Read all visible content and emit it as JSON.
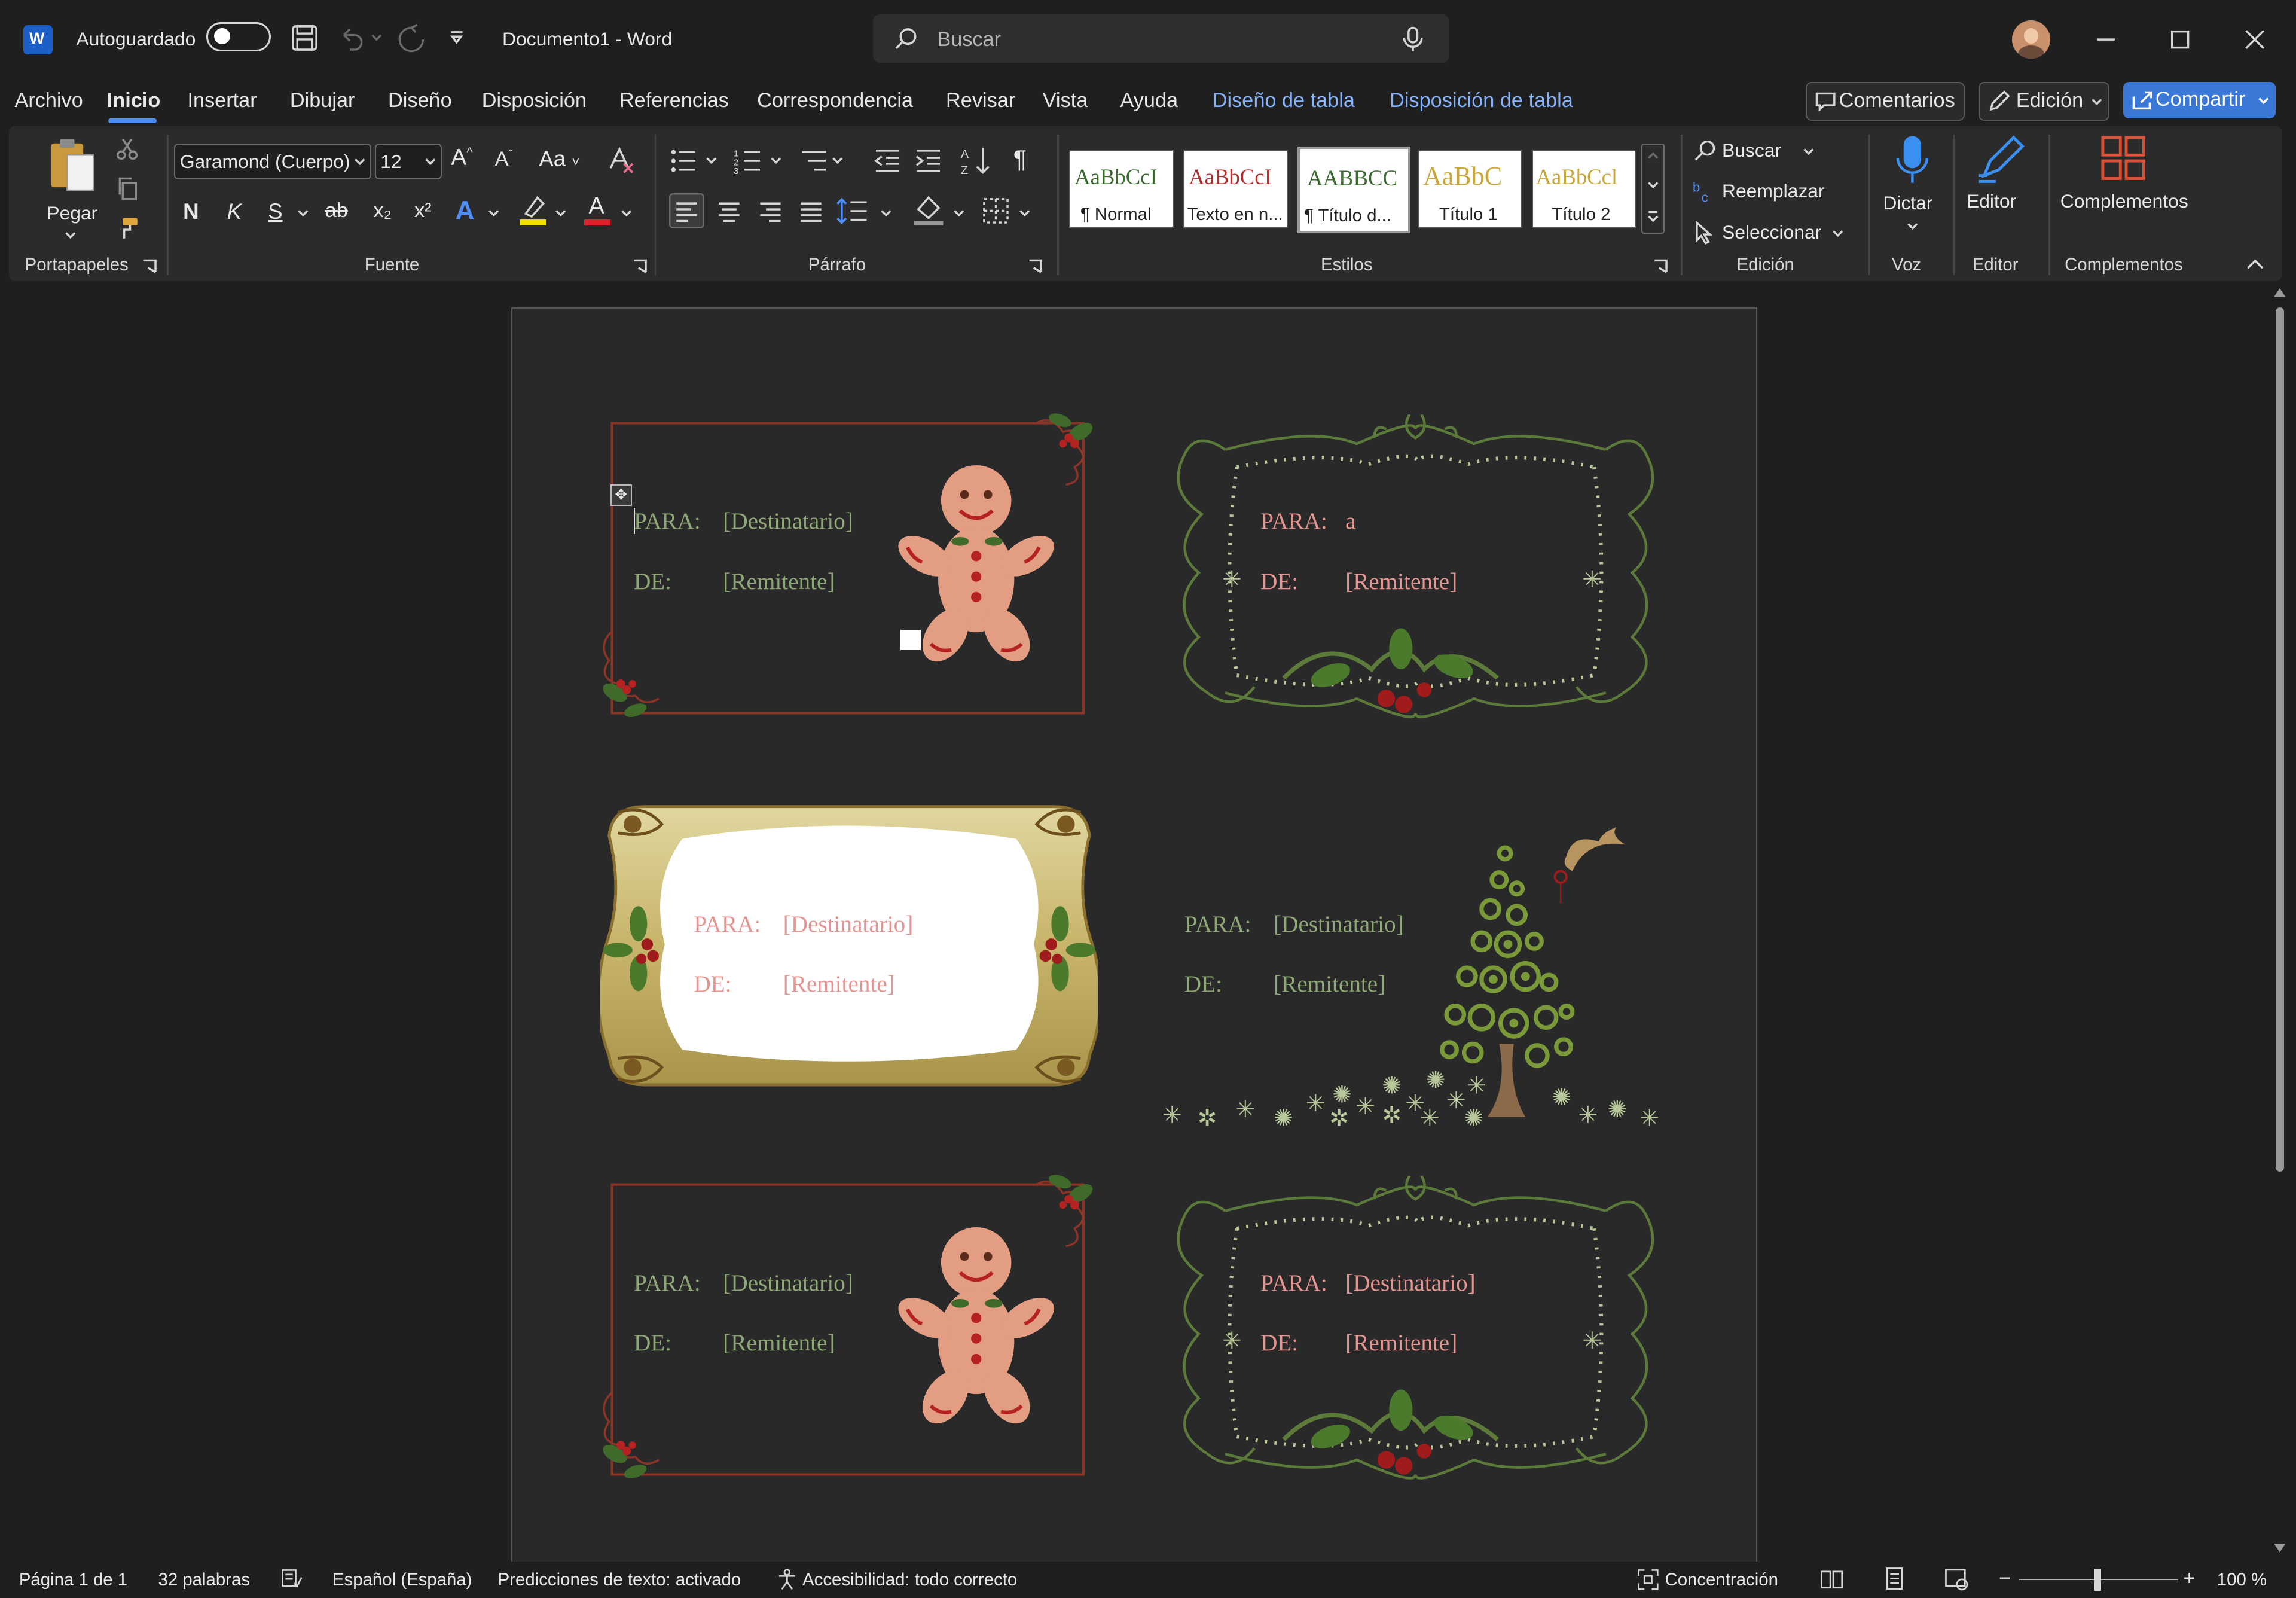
{
  "title": {
    "autosave_label": "Autoguardado",
    "doc_title": "Documento1  -  Word",
    "search_placeholder": "Buscar"
  },
  "menu": {
    "items": [
      "Archivo",
      "Inicio",
      "Insertar",
      "Dibujar",
      "Diseño",
      "Disposición",
      "Referencias",
      "Correspondencia",
      "Revisar",
      "Vista",
      "Ayuda"
    ],
    "contextual": [
      "Diseño de tabla",
      "Disposición de tabla"
    ],
    "comments": "Comentarios",
    "editing": "Edición",
    "share": "Compartir"
  },
  "ribbon": {
    "paste": "Pegar",
    "font_name": "Garamond (Cuerpo)",
    "font_size": "12",
    "case_label": "Aa",
    "bold": "N",
    "italic": "K",
    "underline": "S",
    "strike": "ab",
    "sub": "x₂",
    "sup": "x²",
    "styles": [
      {
        "preview": "AaBbCcI",
        "name": "¶ Normal",
        "color": "#3a6b2f"
      },
      {
        "preview": "AaBbCcI",
        "name": "Texto en n...",
        "color": "#b03030"
      },
      {
        "preview": "AABBCC",
        "name": "¶ Título d...",
        "color": "#3a6b2f"
      },
      {
        "preview": "AaBbC",
        "name": "Título 1",
        "color": "#c9a73a"
      },
      {
        "preview": "AaBbCcl",
        "name": "Título 2",
        "color": "#c9a73a"
      }
    ],
    "search": "Buscar",
    "replace": "Reemplazar",
    "select": "Seleccionar",
    "dictate": "Dictar",
    "editor": "Editor",
    "addins": "Complementos",
    "groups": {
      "clipboard": "Portapapeles",
      "font": "Fuente",
      "paragraph": "Párrafo",
      "styles": "Estilos",
      "editing": "Edición",
      "voice": "Voz",
      "editor": "Editor",
      "addins": "Complementos"
    }
  },
  "labels": {
    "para": "PARA:",
    "de": "DE:",
    "recipient": "[Destinatario]",
    "sender": "[Remitente]",
    "typed_recipient": "a"
  },
  "status": {
    "page": "Página 1 de 1",
    "words": "32 palabras",
    "language": "Español (España)",
    "predictions": "Predicciones de texto: activado",
    "accessibility": "Accesibilidad: todo correcto",
    "focus": "Concentración",
    "zoom_minus": "−",
    "zoom_plus": "+",
    "zoom": "100 %"
  },
  "colors": {
    "accent": "#4f8ef7",
    "share_bg": "#3a78d8",
    "contextual_tab": "#8ab4f8",
    "label_green": "#8fa877",
    "label_pink": "#e59591"
  }
}
